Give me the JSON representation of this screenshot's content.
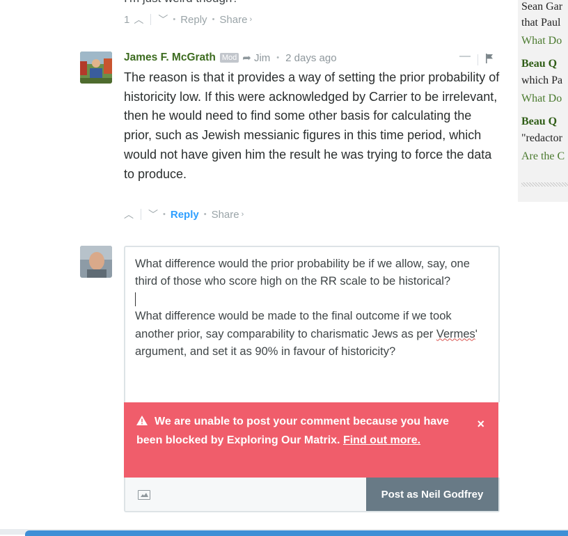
{
  "previous_comment": {
    "text_partial": "I'm just weird though?",
    "votes": "1",
    "reply_label": "Reply",
    "share_label": "Share",
    "share_arrow": "›"
  },
  "comment": {
    "author": "James F. McGrath",
    "badge": "Mod",
    "reply_to": "Jim",
    "time": "2 days ago",
    "collapse": "—",
    "body": "The reason is that it provides a way of setting the prior probability of historicity low. If this were acknowledged by Carrier to be irrelevant, then he would need to find some other basis for calculating the prior, such as Jewish messianic figures in this time period, which would not have given him the result he was trying to force the data to produce.",
    "reply_label": "Reply",
    "share_label": "Share",
    "share_arrow": "›"
  },
  "reply_box": {
    "para1": "What difference would the prior probability be if we allow, say, one third of those who score high on the RR scale to be historical?",
    "para2_before": "What difference would be made to the final outcome if we took another prior, say comparability to charismatic Jews as per ",
    "para2_misspelled": "Vermes",
    "para2_after": "' argument, and set it as 90% in favour of historicity?"
  },
  "alert": {
    "icon": "warning-icon",
    "message": "We are unable to post your comment because you have been blocked by Exploring Our Matrix.",
    "link_text": "Find out more.",
    "close": "×",
    "color": "#f05d6b"
  },
  "post_button": {
    "label": "Post as Neil Godfrey",
    "color": "#687a86"
  },
  "sidebar": {
    "lines": [
      {
        "text": "Sean Gar",
        "style": "plain"
      },
      {
        "text": "that Paul",
        "style": "plain"
      },
      {
        "text": "What Do",
        "style": "link"
      },
      {
        "text": "Beau Q",
        "style": "bold"
      },
      {
        "text": "which Pa",
        "style": "plain"
      },
      {
        "text": "What Do",
        "style": "link"
      },
      {
        "text": "Beau Q",
        "style": "bold"
      },
      {
        "text": "\"redactor",
        "style": "plain"
      },
      {
        "text": "Are the C",
        "style": "link"
      }
    ]
  },
  "colors": {
    "author": "#3c6b1f",
    "reply_active": "#2e9fff",
    "sidebar_link": "#4a7a2e"
  }
}
